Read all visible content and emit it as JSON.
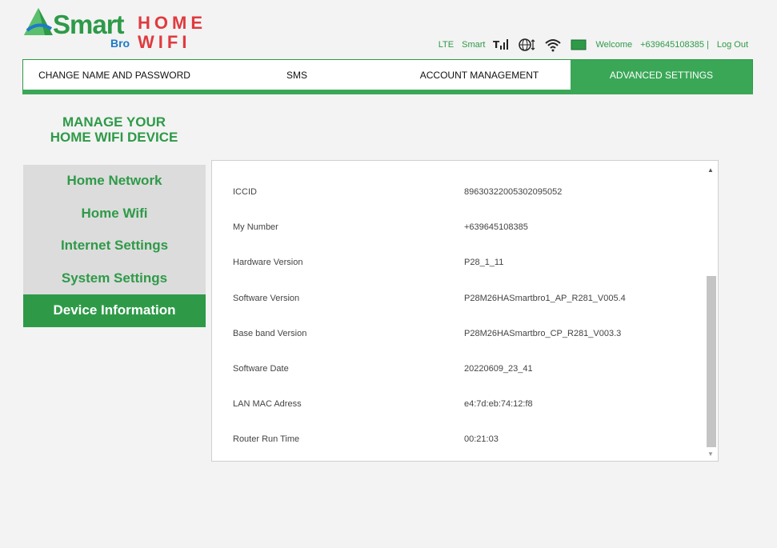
{
  "brand": {
    "name": "Smart",
    "sub": "Bro",
    "line1": "HOME",
    "line2": "WIFI",
    "green": "#2e9a48",
    "red": "#e03a3e",
    "blue": "#1f79c8"
  },
  "status": {
    "network_type": "LTE",
    "carrier": "Smart",
    "welcome": "Welcome",
    "number": "+639645108385 |",
    "logout": "Log Out",
    "icons": [
      "signal-icon",
      "globe-data-icon",
      "wifi-icon",
      "sim-icon"
    ]
  },
  "nav": {
    "tabs": [
      {
        "label": "CHANGE NAME AND PASSWORD"
      },
      {
        "label": "SMS"
      },
      {
        "label": "ACCOUNT MANAGEMENT"
      },
      {
        "label": "ADVANCED SETTINGS",
        "active": true
      }
    ]
  },
  "sidebar": {
    "title_line1": "MANAGE YOUR",
    "title_line2": "HOME WIFI DEVICE",
    "items": [
      {
        "label": "Home Network"
      },
      {
        "label": "Home Wifi"
      },
      {
        "label": "Internet Settings"
      },
      {
        "label": "System Settings"
      },
      {
        "label": "Device Information",
        "active": true
      }
    ]
  },
  "device_info": {
    "rows": [
      {
        "label": "ICCID",
        "value": "8963032200530209505​2"
      },
      {
        "label": "My Number",
        "value": "+639645108385"
      },
      {
        "label": "Hardware Version",
        "value": "P28_1_11"
      },
      {
        "label": "Software Version",
        "value": "P28M26HASmartbro1_AP_R281_V005.4"
      },
      {
        "label": "Base band Version",
        "value": "P28M26HASmartbro_CP_R281_V003.3"
      },
      {
        "label": "Software Date",
        "value": "20220609_23_41"
      },
      {
        "label": "LAN MAC Adress",
        "value": "e4:7d:eb:74:12:f8"
      },
      {
        "label": "Router Run Time",
        "value": "00:21:03"
      }
    ]
  }
}
